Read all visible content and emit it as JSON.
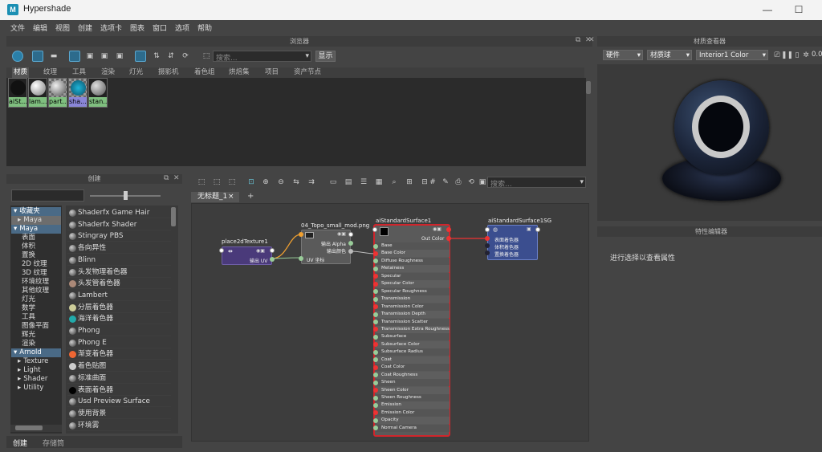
{
  "window": {
    "title": "Hypershade"
  },
  "menu": [
    "文件",
    "编辑",
    "视图",
    "创建",
    "选项卡",
    "图表",
    "窗口",
    "选项",
    "帮助"
  ],
  "browser": {
    "title": "浏览器",
    "search_placeholder": "搜索...",
    "show_button": "显示",
    "tabs": [
      "材质",
      "纹理",
      "工具",
      "渲染",
      "灯光",
      "摄影机",
      "着色组",
      "烘焙集",
      "项目",
      "资产节点"
    ],
    "swatches": [
      {
        "label": "aiSt..."
      },
      {
        "label": "lam..."
      },
      {
        "label": "part..."
      },
      {
        "label": "sha..."
      },
      {
        "label": "stan..."
      }
    ]
  },
  "create_panel": {
    "title": "创建",
    "tree": [
      {
        "label": "收藏夹",
        "group": true
      },
      {
        "label": "Maya"
      },
      {
        "label": "Maya",
        "group": true
      },
      {
        "label": "表面"
      },
      {
        "label": "体积"
      },
      {
        "label": "置换"
      },
      {
        "label": "2D 纹理"
      },
      {
        "label": "3D 纹理"
      },
      {
        "label": "环境纹理"
      },
      {
        "label": "其他纹理"
      },
      {
        "label": "灯光"
      },
      {
        "label": "数学"
      },
      {
        "label": "工具"
      },
      {
        "label": "图像平面"
      },
      {
        "label": "辉光"
      },
      {
        "label": "渲染"
      },
      {
        "label": "Arnold",
        "group": true
      },
      {
        "label": "Texture"
      },
      {
        "label": "Light"
      },
      {
        "label": "Shader"
      },
      {
        "label": "Utility"
      }
    ],
    "nodes": [
      "Shaderfx Game Hair",
      "Shaderfx Shader",
      "Stingray PBS",
      "各向异性",
      "Blinn",
      "头发物理着色器",
      "头发管着色器",
      "Lambert",
      "分层着色器",
      "海洋着色器",
      "Phong",
      "Phong E",
      "渐变着色器",
      "着色贴图",
      "标准曲面",
      "表面着色器",
      "Usd Preview Surface",
      "使用背景",
      "环境雾"
    ],
    "bottom_tabs": [
      "创建",
      "存储筒"
    ]
  },
  "node_editor": {
    "tab_label": "无标题_1",
    "close_glyph": "×",
    "add_tab": "+",
    "search_placeholder": "搜索...",
    "nodes": {
      "place2d": {
        "name": "place2dTexture1",
        "out": "输出 UV"
      },
      "file": {
        "name": "04_Topo_small_mod.png",
        "out_alpha": "输出 Alpha",
        "out_color": "输出颜色",
        "uv": "UV 坐标"
      },
      "surface": {
        "name": "aiStandardSurface1",
        "out_color": "Out Color",
        "attrs": [
          "Base",
          "Base Color",
          "Diffuse Roughness",
          "Metalness",
          "Specular",
          "Specular Color",
          "Specular Roughness",
          "Transmission",
          "Transmission Color",
          "Transmission Depth",
          "Transmission Scatter",
          "Transmission Extra Roughness",
          "Subsurface",
          "Subsurface Color",
          "Subsurface Radius",
          "Coat",
          "Coat Color",
          "Coat Roughness",
          "Sheen",
          "Sheen Color",
          "Sheen Roughness",
          "Emission",
          "Emission Color",
          "Opacity",
          "Normal Camera"
        ]
      },
      "sg": {
        "name": "aiStandardSurface1SG",
        "ports": [
          "表面着色器",
          "体积着色器",
          "置换着色器"
        ]
      }
    }
  },
  "material_viewer": {
    "title": "材质查看器",
    "renderer": "硬件",
    "shape": "材质球",
    "environment": "Interior1 Color",
    "readout": "0.0"
  },
  "attribute_editor": {
    "title": "特性编辑器",
    "message": "进行选择以查看属性"
  },
  "colors": {
    "accent": "#4a6a86",
    "selection_red": "#d0252c",
    "sg_node": "#3b4e8f",
    "place_node": "#4a3a7a"
  }
}
